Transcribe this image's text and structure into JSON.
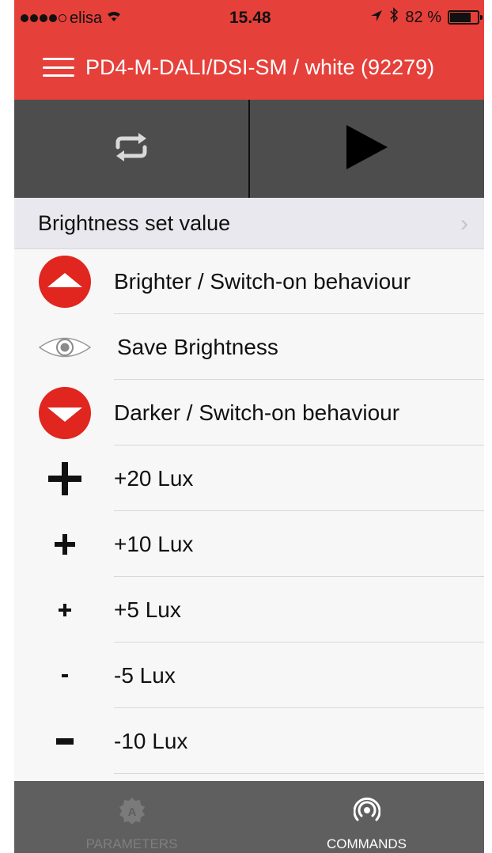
{
  "status_bar": {
    "carrier": "elisa",
    "time": "15.48",
    "battery_label": "82 %",
    "battery_level": 0.82
  },
  "header": {
    "title": "PD4-M-DALI/DSI-SM / white  (92279)"
  },
  "controls": {
    "left_icon": "repeat-icon",
    "right_icon": "play-icon"
  },
  "section": {
    "title": "Brightness set value"
  },
  "commands": [
    {
      "icon": "arrow-up-circle-icon",
      "label": "Brighter / Switch-on behaviour"
    },
    {
      "icon": "eye-icon",
      "label": "Save Brightness"
    },
    {
      "icon": "arrow-down-circle-icon",
      "label": "Darker / Switch-on behaviour"
    },
    {
      "icon": "plus-large-icon",
      "label": "+20 Lux"
    },
    {
      "icon": "plus-medium-icon",
      "label": "+10 Lux"
    },
    {
      "icon": "plus-small-icon",
      "label": "+5 Lux"
    },
    {
      "icon": "minus-small-icon",
      "label": "-5 Lux"
    },
    {
      "icon": "minus-medium-icon",
      "label": "-10 Lux"
    }
  ],
  "tabs": [
    {
      "label": "PARAMETERS",
      "icon": "parameters-badge-icon",
      "active": false
    },
    {
      "label": "COMMANDS",
      "icon": "broadcast-icon",
      "active": true
    }
  ],
  "colors": {
    "brand_red": "#e6403a",
    "command_red": "#e0261f",
    "control_gray": "#4d4d4d",
    "tab_gray": "#5f5f5f"
  }
}
